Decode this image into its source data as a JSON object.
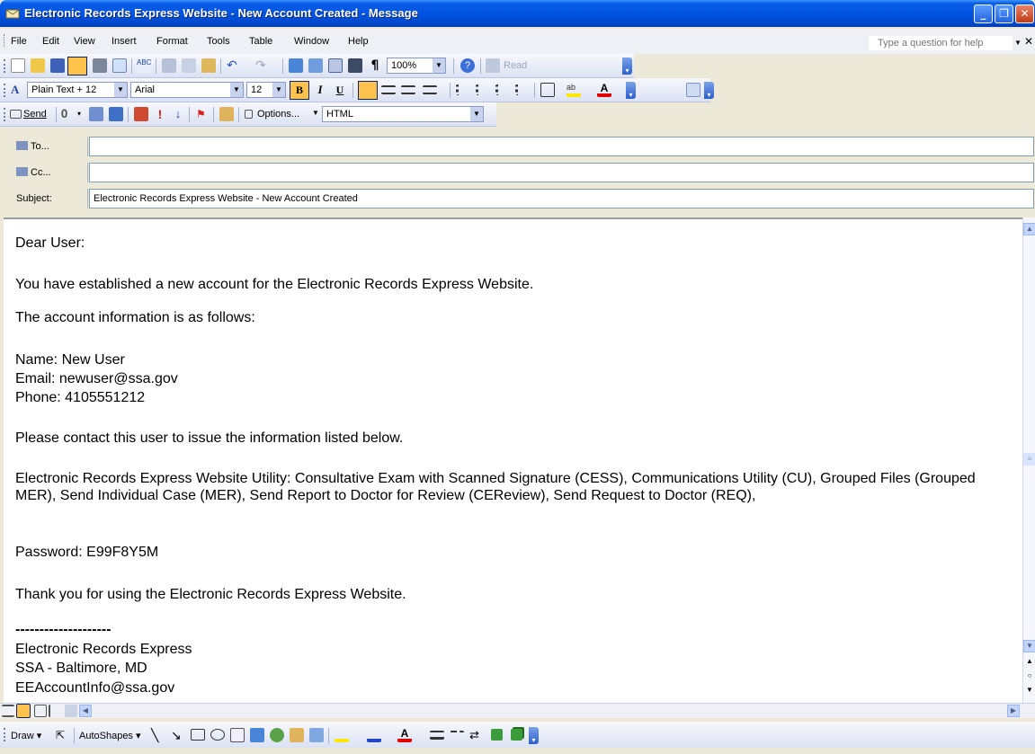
{
  "window": {
    "title": "Electronic Records Express Website - New Account Created - Message"
  },
  "menu": {
    "items": [
      "File",
      "Edit",
      "View",
      "Insert",
      "Format",
      "Tools",
      "Table",
      "Window",
      "Help"
    ],
    "help_placeholder": "Type a question for help"
  },
  "toolbar_standard": {
    "zoom": "100%",
    "read_label": "Read"
  },
  "toolbar_formatting": {
    "style": "Plain Text + 12",
    "font": "Arial",
    "size": "12",
    "bold": "B",
    "italic": "I",
    "underline": "U"
  },
  "toolbar_email": {
    "send_label": "Send",
    "options_label": "Options...",
    "format": "HTML"
  },
  "header": {
    "to_label": "To...",
    "cc_label": "Cc...",
    "subject_label": "Subject:",
    "to_value": "",
    "cc_value": "",
    "subject_value": "Electronic Records Express Website - New Account Created"
  },
  "message": {
    "greeting": "Dear User:",
    "line1": "You have established a new account for the Electronic Records Express Website.",
    "line2": "The account information is as follows:",
    "name": "Name:  New User",
    "email": "Email:  newuser@ssa.gov",
    "phone": "Phone:  4105551212",
    "contact": "Please contact this user to issue the information listed below.",
    "utility": "Electronic Records Express Website Utility: Consultative Exam with Scanned Signature (CESS), Communications Utility (CU), Grouped Files (Grouped MER), Send Individual Case (MER), Send Report to Doctor for Review (CEReview), Send Request to Doctor (REQ),",
    "password": "Password: E99F8Y5M",
    "thanks": "Thank you for using the Electronic Records Express Website.",
    "sig_divider": "--------------------",
    "sig_name": "Electronic Records Express",
    "sig_location": "SSA - Baltimore, MD",
    "sig_email": "EEAccountInfo@ssa.gov"
  },
  "drawing_toolbar": {
    "draw_label": "Draw",
    "autoshapes_label": "AutoShapes"
  }
}
